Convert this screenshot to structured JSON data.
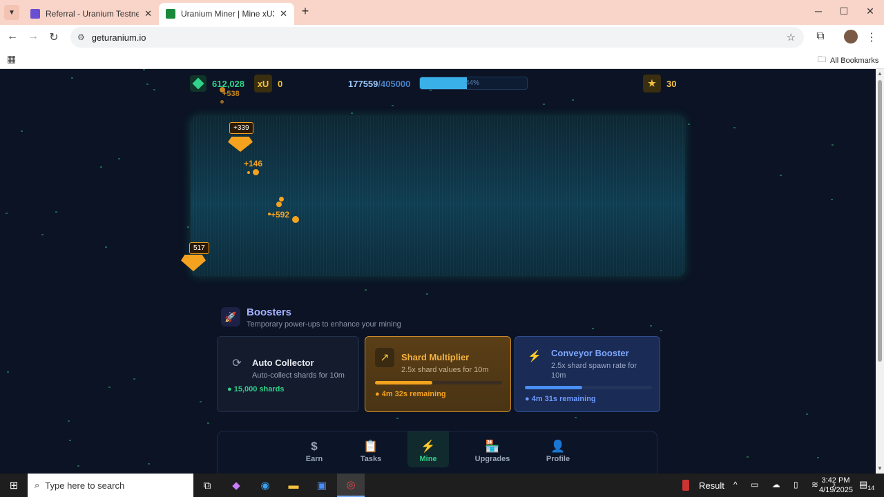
{
  "browser": {
    "tabs": [
      {
        "title": "Referral - Uranium Testnet | Mi",
        "active": false
      },
      {
        "title": "Uranium Miner | Mine xU3O8 T",
        "active": true
      }
    ],
    "url": "geturanium.io",
    "bookmarks_label": "All Bookmarks"
  },
  "header": {
    "shards": "612,028",
    "xu_label": "xU",
    "xu_value": "0",
    "progress_current": "177559",
    "progress_total": "/405000",
    "progress_percent": "44%",
    "progress_fraction": 0.44,
    "stars": "30"
  },
  "mine": {
    "shards": [
      {
        "label": "+339"
      },
      {
        "label": "517"
      }
    ],
    "floats": [
      "+146",
      "+592",
      "+538"
    ]
  },
  "boosters": {
    "title": "Boosters",
    "subtitle": "Temporary power-ups to enhance your mining",
    "cards": [
      {
        "name": "Auto Collector",
        "desc": "Auto-collect shards for 10m",
        "status": "15,000 shards"
      },
      {
        "name": "Shard Multiplier",
        "desc": "2.5x shard values for 10m",
        "status": "4m 32s remaining",
        "progress": 0.45
      },
      {
        "name": "Conveyor Booster",
        "desc": "2.5x shard spawn rate for 10m",
        "status": "4m 31s remaining",
        "progress": 0.45
      }
    ]
  },
  "nav": {
    "items": [
      {
        "label": "Earn",
        "icon": "dollar-icon"
      },
      {
        "label": "Tasks",
        "icon": "clipboard-icon"
      },
      {
        "label": "Mine",
        "icon": "lightning-icon"
      },
      {
        "label": "Upgrades",
        "icon": "store-icon"
      },
      {
        "label": "Profile",
        "icon": "user-icon"
      }
    ],
    "active": "Mine"
  },
  "taskbar": {
    "search_placeholder": "Type here to search",
    "result_label": "Result",
    "time": "3:42 PM",
    "date": "4/19/2025",
    "notification_count": "14"
  },
  "colors": {
    "accent_green": "#2fd38a",
    "accent_orange": "#f5a31f",
    "accent_blue": "#4a8ef5",
    "progress_cyan": "#3ab0e8"
  }
}
